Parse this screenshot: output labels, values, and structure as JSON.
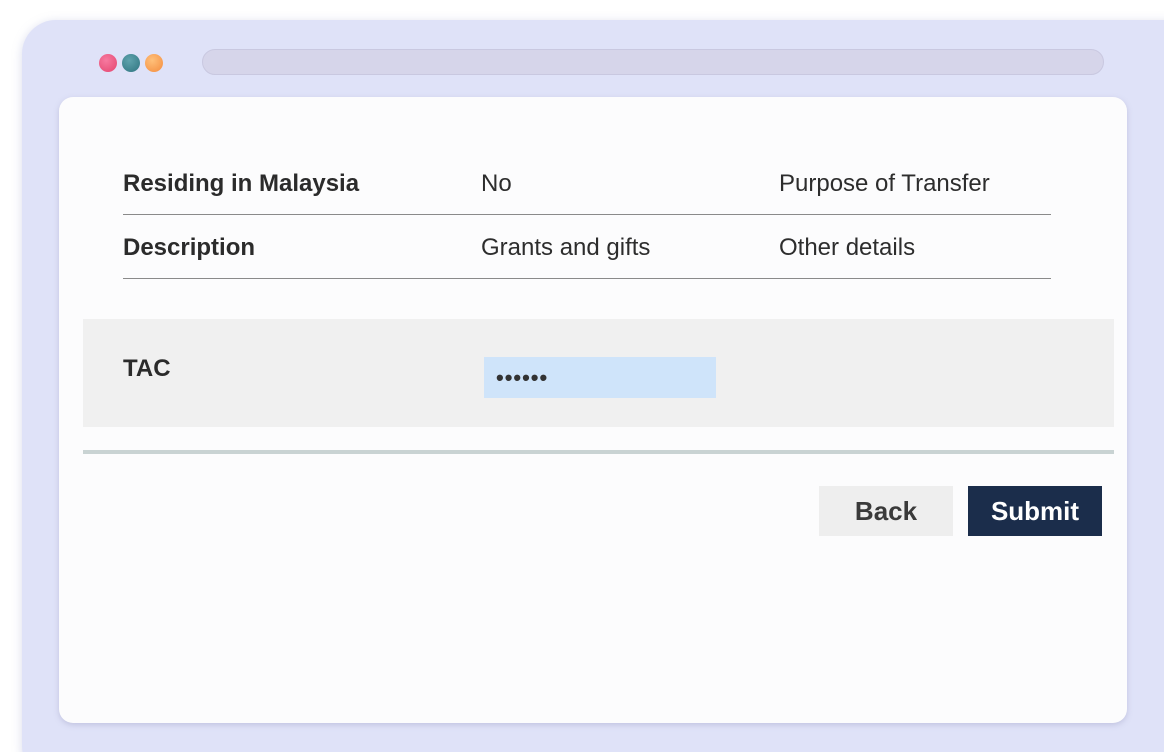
{
  "window": {
    "controls": [
      "close-dot",
      "minimize-dot",
      "zoom-dot"
    ]
  },
  "details": [
    {
      "label": "Residing in Malaysia",
      "value": "No",
      "extra": "Purpose of Transfer"
    },
    {
      "label": "Description",
      "value": "Grants and gifts",
      "extra": "Other details"
    }
  ],
  "tac": {
    "label": "TAC",
    "value": "••••••"
  },
  "actions": {
    "back_label": "Back",
    "submit_label": "Submit"
  },
  "colors": {
    "frame": "#dfe2f8",
    "submit_button": "#1b2d4b",
    "back_button": "#eeeeee",
    "tac_input": "#cfe4fa",
    "tac_panel": "#f0f0f0"
  }
}
